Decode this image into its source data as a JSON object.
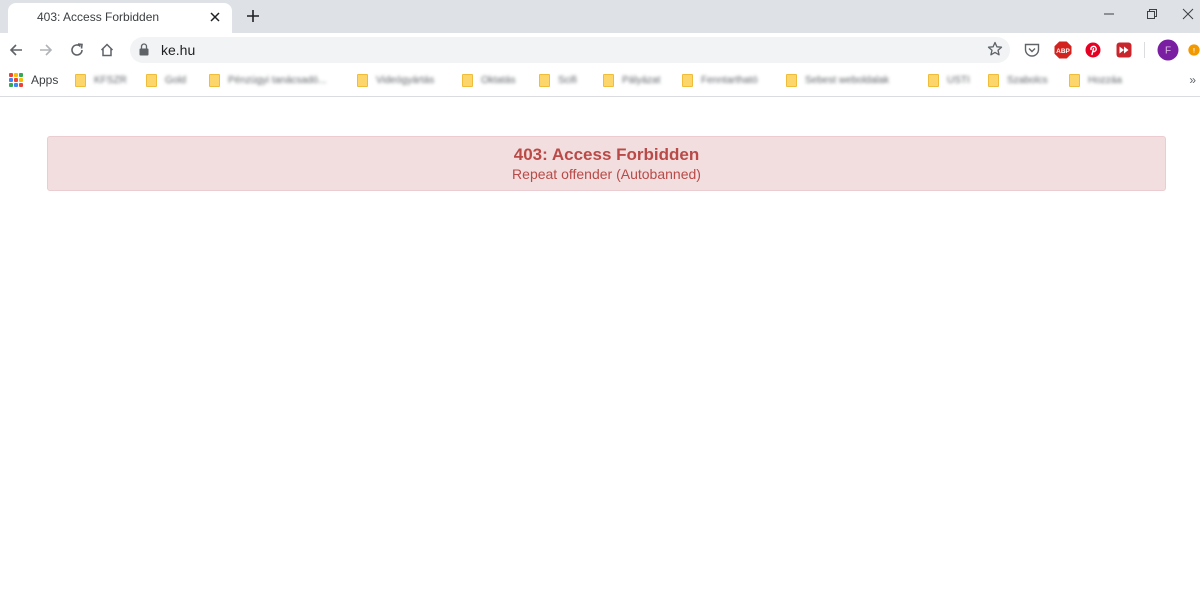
{
  "tab": {
    "title": "403: Access Forbidden"
  },
  "address_bar": {
    "url": "ke.hu"
  },
  "bookmarks": {
    "apps_label": "Apps",
    "items": [
      {
        "label": "KFSZR"
      },
      {
        "label": "Gold"
      },
      {
        "label": "Pénzügyi tanácsadó..."
      },
      {
        "label": "Videógyártás"
      },
      {
        "label": "Oktatás"
      },
      {
        "label": "Scifi"
      },
      {
        "label": "Pályázat"
      },
      {
        "label": "Fenntartható"
      },
      {
        "label": "Sebest weboldalak"
      },
      {
        "label": "USTI"
      },
      {
        "label": "Szabolcs"
      },
      {
        "label": "Hozzáa"
      }
    ],
    "overflow_label": "»"
  },
  "extensions": {
    "abp_label": "ABP",
    "profile_initial": "F",
    "update_label": "!"
  },
  "alert": {
    "title": "403: Access Forbidden",
    "message": "Repeat offender (Autobanned)"
  },
  "colors": {
    "alert_background": "#f2dede",
    "alert_border": "#ebccd1",
    "alert_text": "#b94a48",
    "tabstrip": "#dee1e6",
    "omnibox": "#f1f3f4"
  }
}
